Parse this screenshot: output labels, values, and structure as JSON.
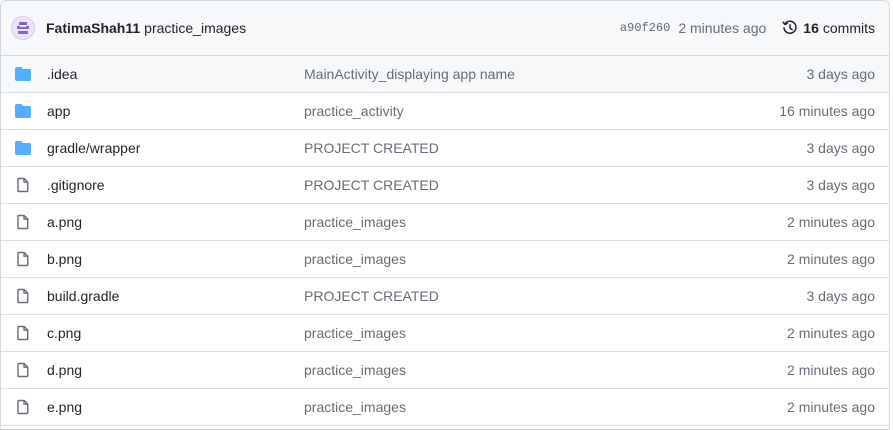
{
  "commit": {
    "author": "FatimaShah11",
    "message": "practice_images",
    "sha": "a90f260",
    "time": "2 minutes ago",
    "commits_count": "16",
    "commits_label": "commits"
  },
  "colors": {
    "folder": "#54aeff",
    "file_icon": "#656d76",
    "muted_text": "#656d76",
    "header_bg": "#f6f8fa",
    "border": "#d0d7de"
  },
  "files": [
    {
      "icon": "folder-icon",
      "name": ".idea",
      "message": "MainActivity_displaying app name",
      "age": "3 days ago"
    },
    {
      "icon": "folder-icon",
      "name": "app",
      "message": "practice_activity",
      "age": "16 minutes ago"
    },
    {
      "icon": "folder-icon",
      "name": "gradle/wrapper",
      "message": "PROJECT CREATED",
      "age": "3 days ago"
    },
    {
      "icon": "file-icon",
      "name": ".gitignore",
      "message": "PROJECT CREATED",
      "age": "3 days ago"
    },
    {
      "icon": "file-icon",
      "name": "a.png",
      "message": "practice_images",
      "age": "2 minutes ago"
    },
    {
      "icon": "file-icon",
      "name": "b.png",
      "message": "practice_images",
      "age": "2 minutes ago"
    },
    {
      "icon": "file-icon",
      "name": "build.gradle",
      "message": "PROJECT CREATED",
      "age": "3 days ago"
    },
    {
      "icon": "file-icon",
      "name": "c.png",
      "message": "practice_images",
      "age": "2 minutes ago"
    },
    {
      "icon": "file-icon",
      "name": "d.png",
      "message": "practice_images",
      "age": "2 minutes ago"
    },
    {
      "icon": "file-icon",
      "name": "e.png",
      "message": "practice_images",
      "age": "2 minutes ago"
    }
  ]
}
